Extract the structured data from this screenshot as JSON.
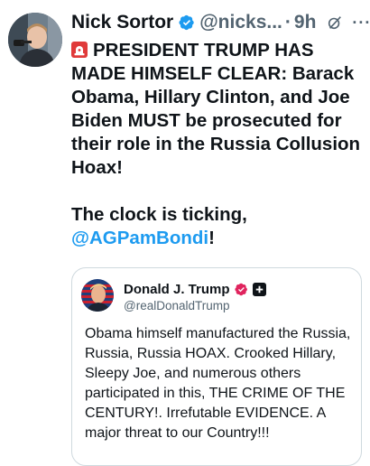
{
  "colors": {
    "accent": "#1d9bf0",
    "muted": "#536471",
    "text": "#0f1419",
    "affiliate_pink": "#e0245e"
  },
  "tweet": {
    "author_name": "Nick Sortor",
    "handle": "@nicks...",
    "separator": "·",
    "time": "9h",
    "more": "···",
    "line_main": "PRESIDENT TRUMP HAS MADE HIMSELF CLEAR: Barack Obama, Hillary Clinton, and Joe Biden MUST be prosecuted for their role in the Russia Collusion Hoax!",
    "line_clock": "The clock is ticking,",
    "mention": "@AGPamBondi",
    "mention_suffix": "!"
  },
  "quote": {
    "author_name": "Donald J. Trump",
    "handle": "@realDonaldTrump",
    "text": "Obama himself manufactured the Russia, Russia, Russia HOAX. Crooked Hillary, Sleepy Joe, and numerous others participated in this, THE CRIME OF THE CENTURY!. Irrefutable EVIDENCE. A major threat to our Country!!!"
  }
}
